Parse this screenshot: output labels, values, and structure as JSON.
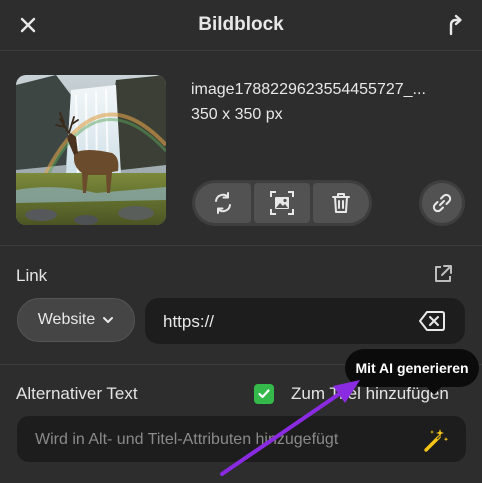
{
  "header": {
    "title": "Bildblock",
    "close_icon": "close-icon",
    "share_icon": "upload-arrow-icon"
  },
  "image": {
    "filename": "image1788229623554455727_...",
    "dimensions": "350 x 350 px",
    "actions": [
      "replace-icon",
      "crop-image-icon",
      "trash-icon"
    ],
    "link_icon": "link-icon"
  },
  "link": {
    "label": "Link",
    "external_icon": "external-link-icon",
    "type_select": "Website",
    "url_value": "https://",
    "clear_icon": "backspace-clear-icon"
  },
  "alt_text": {
    "label": "Alternativer Text",
    "title_checkbox_checked": true,
    "title_checkbox_label": "Zum Titel hinzufügen",
    "placeholder": "Wird in Alt- und Titel-Attributen hinzugefügt",
    "ai_icon": "magic-wand-icon"
  },
  "tooltip": {
    "text": "Mit AI generieren"
  },
  "colors": {
    "panel_bg": "#2d2d2d",
    "field_bg": "#1d1d1d",
    "checkbox": "#35b94a",
    "wand": "#f5c518",
    "annotation_arrow": "#8a2be2"
  }
}
